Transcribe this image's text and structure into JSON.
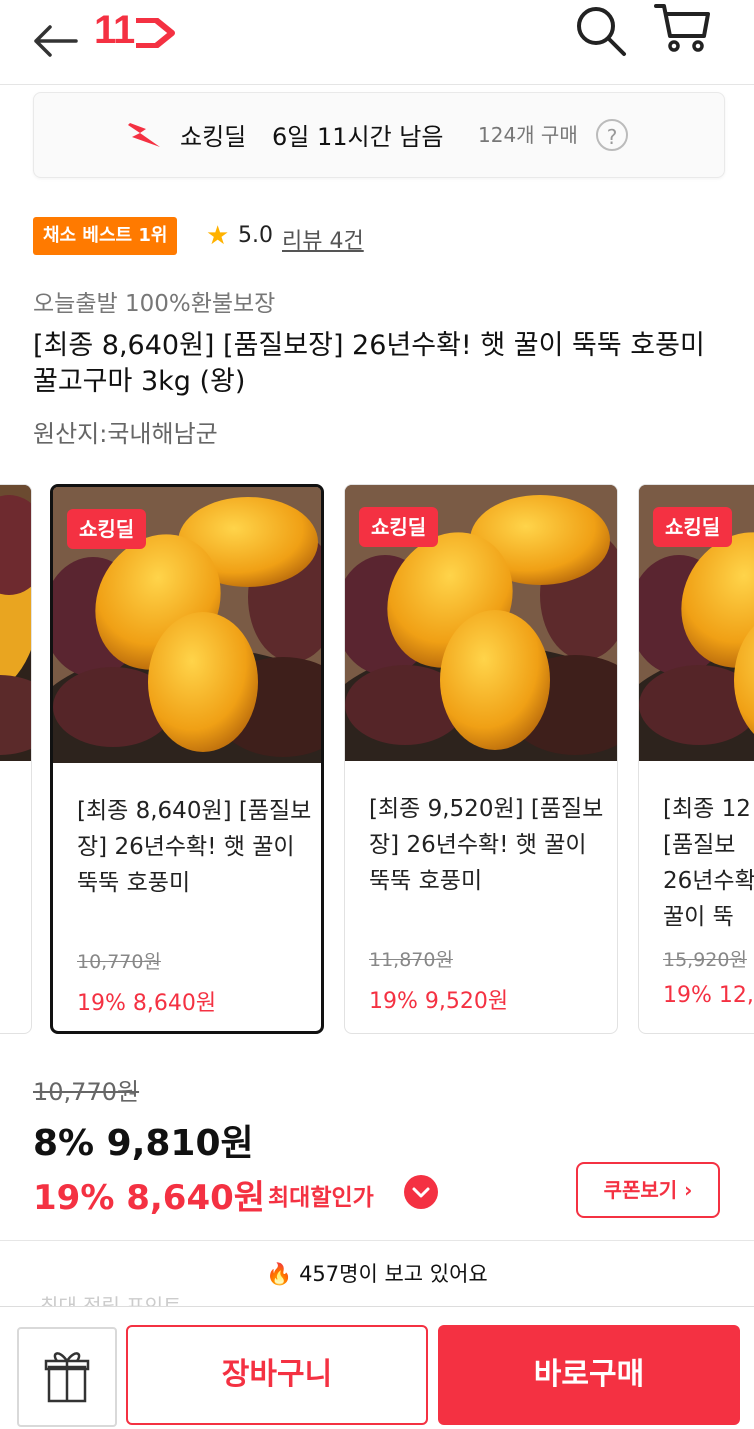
{
  "header": {
    "back_icon": "arrow-left-icon",
    "logo_text": "11",
    "search_icon": "search-icon",
    "cart_icon": "cart-icon"
  },
  "deal_banner": {
    "label": "쇼킹딜",
    "remaining": "6일 11시간 남음",
    "purchase_count": "124개 구매",
    "help": "?"
  },
  "badge": {
    "text": "채소 베스트 1위",
    "color": "#ff7a00"
  },
  "rating": {
    "score": "5.0",
    "review_link": "리뷰 4건"
  },
  "product": {
    "promo": "오늘출발 100%환불보장",
    "title": "[최종 8,640원] [품질보장] 26년수확! 햇 꿀이 뚝뚝 호풍미 꿀고구마 3kg (왕)",
    "origin": "원산지:국내해남군"
  },
  "carousel": {
    "cards": [
      {
        "tag": "쇼킹딜",
        "name": "[최종 8,640원] [품질보장] 26년수확! 햇 꿀이 뚝뚝 호풍미",
        "original_price": "10,770원",
        "sale_price": "19% 8,640원"
      },
      {
        "tag": "쇼킹딜",
        "name": "[최종 9,520원] [품질보장] 26년수확! 햇 꿀이 뚝뚝 호풍미",
        "original_price": "11,870원",
        "sale_price": "19% 9,520원"
      },
      {
        "tag": "쇼킹딜",
        "name": "[최종 12,",
        "name_lines": [
          "[최종 12",
          "[품질보",
          "26년수확",
          "꿀이 뚝"
        ],
        "original_price": "15,920원",
        "sale_price": "19% 12,"
      }
    ]
  },
  "price": {
    "original": "10,770원",
    "discounted": "8% 9,810원",
    "max_discount": "19% 8,640원",
    "max_label": "최대할인가",
    "coupon_button": "쿠폰보기"
  },
  "viewers": "🔥 457명이 보고 있어요",
  "faded_text": "최대 적립 포인트",
  "bottom": {
    "gift_icon": "gift-icon",
    "cart_button": "장바구니",
    "buy_button": "바로구매"
  },
  "colors": {
    "brand_red": "#f43142",
    "badge_orange": "#ff7a00",
    "star": "#ffb200"
  }
}
